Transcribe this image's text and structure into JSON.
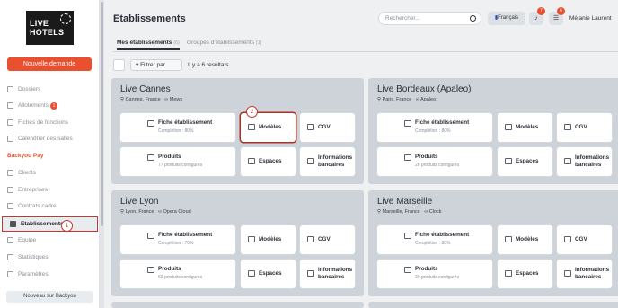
{
  "brand": {
    "line1": "LIVE",
    "line2": "HOTELS"
  },
  "sidebar": {
    "new_request": "Nouvelle demande",
    "items": [
      {
        "label": "Dossiers"
      },
      {
        "label": "Allotements",
        "badge": "1"
      },
      {
        "label": "Fiches de fonctions"
      },
      {
        "label": "Calendrier des salles"
      },
      {
        "label": "Backyou Pay"
      },
      {
        "label": "Clients"
      },
      {
        "label": "Entreprises"
      },
      {
        "label": "Contrats cadre"
      },
      {
        "label": "Etablissements"
      },
      {
        "label": "Equipe"
      },
      {
        "label": "Statistiques"
      },
      {
        "label": "Paramètres"
      }
    ],
    "new_on": "Nouveau sur Backyou",
    "step_marker": "1"
  },
  "header": {
    "title": "Etablissements",
    "search_placeholder": "Rechercher...",
    "lang": "Français",
    "notif_count": "7",
    "tasks_count": "6",
    "user_name": "Mélanie Laurent"
  },
  "tabs": [
    {
      "label": "Mes établissements",
      "count": "(6)"
    },
    {
      "label": "Groupes d'établissements",
      "count": "(1)"
    }
  ],
  "toolbar": {
    "filter": "Filtrer par",
    "results": "Il y a 6 resultats"
  },
  "step2_marker": "2",
  "establishments": [
    {
      "name": "Live Cannes",
      "location": "Cannes, France",
      "pms": "Mews",
      "fiche": "Fiche établissement",
      "completion": "Complétion : 80%",
      "modeles": "Modèles",
      "cgv": "CGV",
      "produits": "Produits",
      "produits_sub": "77 produits configurés",
      "espaces": "Espaces",
      "banc1": "Informations",
      "banc2": "bancaires"
    },
    {
      "name": "Live Bordeaux (Apaleo)",
      "location": "Paris, France",
      "pms": "Apaleo",
      "fiche": "Fiche établissement",
      "completion": "Complétion : 80%",
      "modeles": "Modèles",
      "cgv": "CGV",
      "produits": "Produits",
      "produits_sub": "28 produits configurés",
      "espaces": "Espaces",
      "banc1": "Informations",
      "banc2": "bancaires"
    },
    {
      "name": "Live Lyon",
      "location": "Lyon, France",
      "pms": "Opera Cloud",
      "fiche": "Fiche établissement",
      "completion": "Complétion : 70%",
      "modeles": "Modèles",
      "cgv": "CGV",
      "produits": "Produits",
      "produits_sub": "69 produits configurés",
      "espaces": "Espaces",
      "banc1": "Informations",
      "banc2": "bancaires"
    },
    {
      "name": "Live Marseille",
      "location": "Marseille, France",
      "pms": "Clock",
      "fiche": "Fiche établissement",
      "completion": "Complétion : 80%",
      "modeles": "Modèles",
      "cgv": "CGV",
      "produits": "Produits",
      "produits_sub": "30 produits configurés",
      "espaces": "Espaces",
      "banc1": "Informations",
      "banc2": "bancaires"
    }
  ],
  "colors": {
    "accent": "#e8502f",
    "highlight": "#a93226"
  }
}
